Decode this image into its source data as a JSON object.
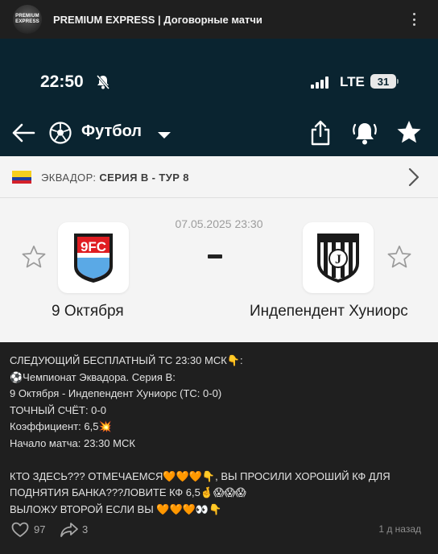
{
  "post": {
    "avatar_text_1": "PREMIUM",
    "avatar_text_2": "EXPRESS",
    "channel_name": "PREMIUM EXPRESS | Договорные матчи",
    "more_icon": "more-dots-icon"
  },
  "phone": {
    "time": "22:50",
    "network": "LTE",
    "battery": "31"
  },
  "app": {
    "sport": "Футбол",
    "icons": [
      "back-arrow-icon",
      "soccer-ball-icon",
      "caret-down-icon",
      "share-icon",
      "bell-icon",
      "star-icon"
    ]
  },
  "league": {
    "country": "ЭКВАДОР:",
    "name": "СЕРИЯ B - ТУР 8"
  },
  "match": {
    "datetime": "07.05.2025 23:30",
    "score": "-",
    "home": "9 Октября",
    "away": "Индепендент Хуниорс",
    "home_logo_text": "9FC",
    "away_logo_text": "J"
  },
  "text": {
    "l1": "СЛЕДУЮЩИЙ БЕСПЛАТНЫЙ ТС 23:30 МСК👇:",
    "l2": "⚽Чемпионат Эквадора. Серия B:",
    "l3": "9 Октября - Индепендент Хуниорс (ТС: 0-0)",
    "l4": "ТОЧНЫЙ СЧЁТ: 0-0",
    "l5": "Коэффициент: 6,5💥",
    "l6": "Начало матча: 23:30 МСК",
    "l7": "КТО ЗДЕСЬ??? ОТМЕЧАЕМСЯ🧡🧡🧡👇, ВЫ ПРОСИЛИ ХОРОШИЙ КФ ДЛЯ",
    "l8": "ПОДНЯТИЯ БАНКА???ЛОВИТЕ КФ 6,5🤞😱😱😱",
    "l9": "ВЫЛОЖУ ВТОРОЙ ЕСЛИ ВЫ 🧡🧡🧡👀👇"
  },
  "footer": {
    "likes": "97",
    "shares": "3",
    "time": "1 д назад"
  },
  "colors": {
    "background": "#1f1f1f",
    "phone_header": "#0a2430",
    "match_bg": "#f4f4f4"
  }
}
